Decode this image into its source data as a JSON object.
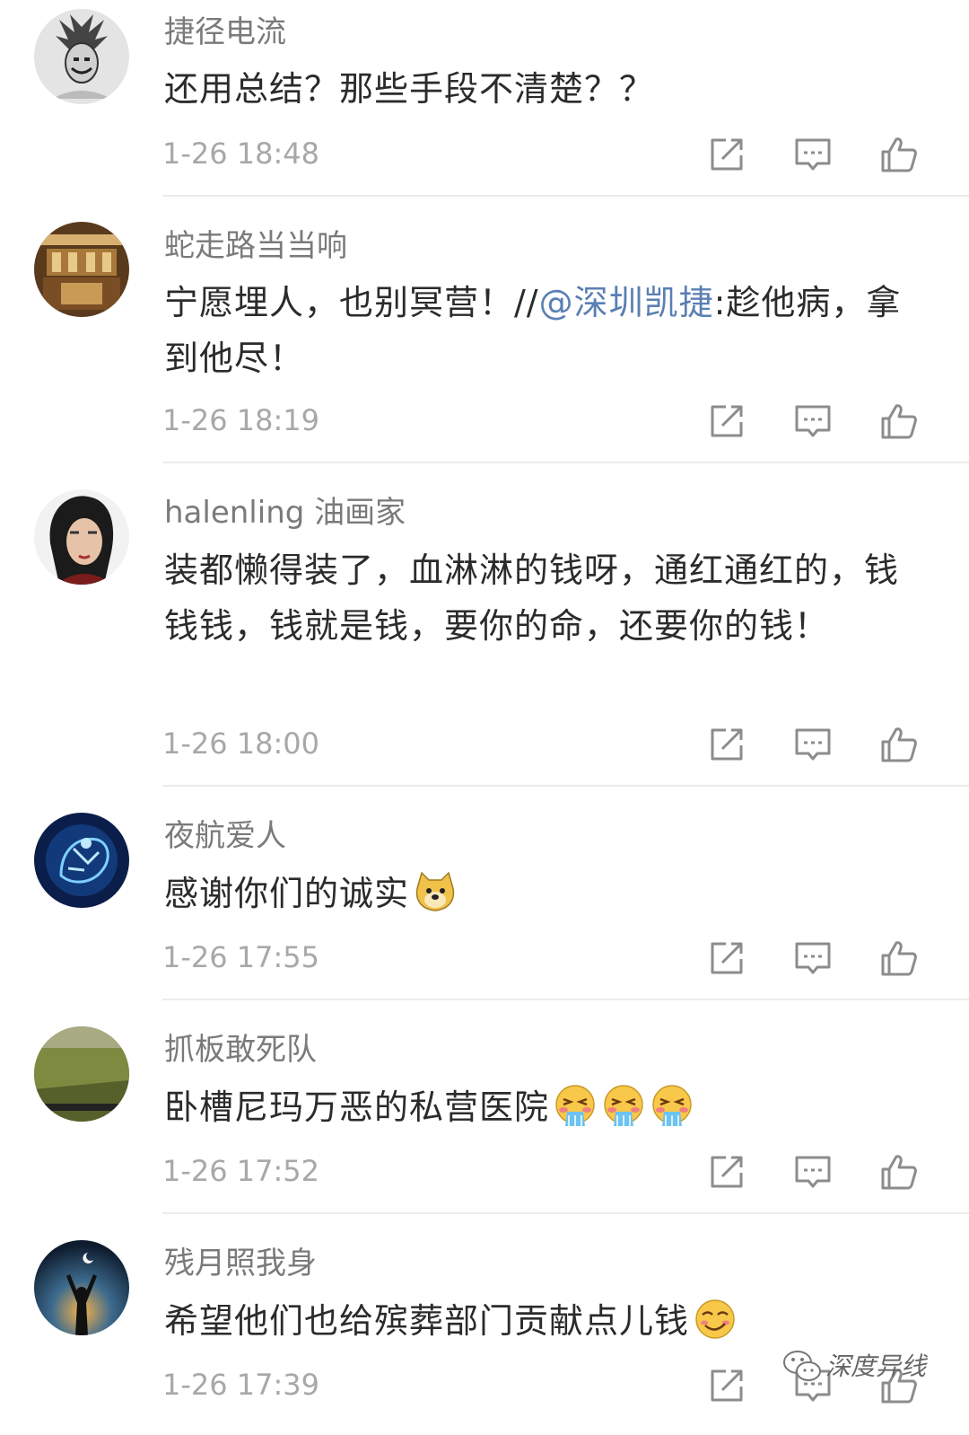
{
  "comments": [
    {
      "username": "捷径电流",
      "text": "还用总结？那些手段不清楚？？",
      "time": "1-26 18:48",
      "avatar": "anime-hero-avatar"
    },
    {
      "username": "蛇走路当当响",
      "text_before": "宁愿埋人，也别冥营！//",
      "mention": "@深圳凯捷",
      "text_after": ":趁他病，拿到他尽！",
      "time": "1-26 18:19",
      "avatar": "theater-stage-avatar"
    },
    {
      "username": "halenling 油画家",
      "text": "装都懒得装了，血淋淋的钱呀，通红通红的，钱钱钱，钱就是钱，要你的命，还要你的钱！",
      "time": "1-26 18:00",
      "avatar": "woman-portrait-avatar"
    },
    {
      "username": "夜航爱人",
      "text": "感谢你们的诚实",
      "time": "1-26 17:55",
      "avatar": "blue-glow-avatar",
      "emojis": [
        "doge-emoji"
      ]
    },
    {
      "username": "抓板敢死队",
      "text": "卧槽尼玛万恶的私营医院",
      "time": "1-26 17:52",
      "avatar": "green-wall-avatar",
      "emojis": [
        "vomit-emoji",
        "vomit-emoji",
        "vomit-emoji"
      ]
    },
    {
      "username": "残月照我身",
      "text": "希望他们也给殡葬部门贡献点儿钱",
      "time": "1-26 17:39",
      "avatar": "silhouette-sunset-avatar",
      "emojis": [
        "smirk-emoji"
      ]
    }
  ],
  "action_icons": [
    "share-icon",
    "reply-icon",
    "like-icon"
  ],
  "watermark": {
    "text": "深度异线",
    "icon": "wechat-icon"
  },
  "colors": {
    "username": "#7a7a7a",
    "body": "#2b2b2b",
    "time": "#a8a8a8",
    "mention": "#5a7fb3",
    "icon": "#8c8c8c"
  }
}
